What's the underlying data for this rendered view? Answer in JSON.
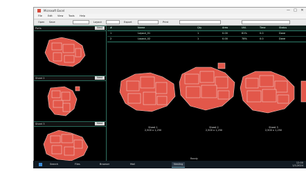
{
  "window": {
    "title": "Microsoft Excel",
    "minimize_glyph": "—",
    "maximize_glyph": "□",
    "close_glyph": "✕"
  },
  "menu": [
    "File",
    "Edit",
    "View",
    "Tools",
    "Help"
  ],
  "toolbar": {
    "items": [
      "Open",
      "Save",
      "Layout",
      "Export",
      "Print"
    ]
  },
  "left_panel": {
    "headers": [
      {
        "label": "Parts",
        "button": "Nest"
      },
      {
        "label": "Sheet 2",
        "button": "Nest"
      },
      {
        "label": "Sheet 3",
        "button": "Nest"
      }
    ]
  },
  "table": {
    "headers": [
      "#",
      "Name",
      "Qty",
      "Area",
      "Util.",
      "Time",
      "Status"
    ],
    "row1": [
      "1",
      "Layout_01",
      "1",
      "0.00",
      "81%",
      "0.0",
      "Done"
    ],
    "row2": [
      "2",
      "Layout_02",
      "1",
      "0.00",
      "78%",
      "0.0",
      "Done"
    ]
  },
  "sheets": [
    {
      "caption_line1": "Sheet 1",
      "caption_line2": "2,500 x 1,250"
    },
    {
      "caption_line1": "Sheet 2",
      "caption_line2": "2,500 x 1,250"
    },
    {
      "caption_line1": "Sheet 3",
      "caption_line2": "2,500 x 1,250"
    }
  ],
  "status_text": "Ready",
  "taskbar": {
    "items": [
      "Search",
      "Files",
      "Browser",
      "Mail",
      "Nesting"
    ],
    "time": "12:00",
    "date": "1/1/2024"
  },
  "colors": {
    "part_fill": "#e2574a",
    "part_edge": "#f3c7c0",
    "window_bg": "#0b0b0b",
    "grid_line": "#2e7d6b"
  }
}
